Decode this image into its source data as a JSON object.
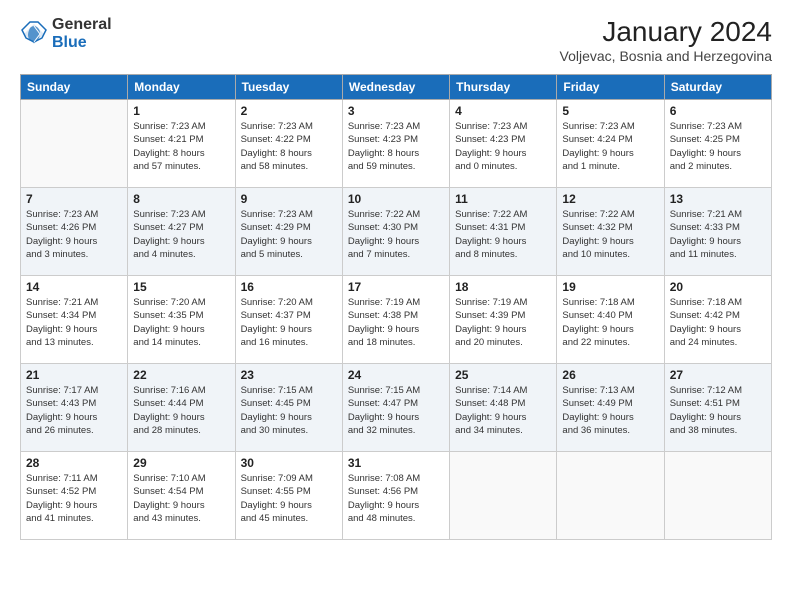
{
  "logo": {
    "general": "General",
    "blue": "Blue"
  },
  "title": "January 2024",
  "location": "Voljevac, Bosnia and Herzegovina",
  "headers": [
    "Sunday",
    "Monday",
    "Tuesday",
    "Wednesday",
    "Thursday",
    "Friday",
    "Saturday"
  ],
  "weeks": [
    [
      {
        "day": "",
        "info": ""
      },
      {
        "day": "1",
        "info": "Sunrise: 7:23 AM\nSunset: 4:21 PM\nDaylight: 8 hours\nand 57 minutes."
      },
      {
        "day": "2",
        "info": "Sunrise: 7:23 AM\nSunset: 4:22 PM\nDaylight: 8 hours\nand 58 minutes."
      },
      {
        "day": "3",
        "info": "Sunrise: 7:23 AM\nSunset: 4:23 PM\nDaylight: 8 hours\nand 59 minutes."
      },
      {
        "day": "4",
        "info": "Sunrise: 7:23 AM\nSunset: 4:23 PM\nDaylight: 9 hours\nand 0 minutes."
      },
      {
        "day": "5",
        "info": "Sunrise: 7:23 AM\nSunset: 4:24 PM\nDaylight: 9 hours\nand 1 minute."
      },
      {
        "day": "6",
        "info": "Sunrise: 7:23 AM\nSunset: 4:25 PM\nDaylight: 9 hours\nand 2 minutes."
      }
    ],
    [
      {
        "day": "7",
        "info": "Sunrise: 7:23 AM\nSunset: 4:26 PM\nDaylight: 9 hours\nand 3 minutes."
      },
      {
        "day": "8",
        "info": "Sunrise: 7:23 AM\nSunset: 4:27 PM\nDaylight: 9 hours\nand 4 minutes."
      },
      {
        "day": "9",
        "info": "Sunrise: 7:23 AM\nSunset: 4:29 PM\nDaylight: 9 hours\nand 5 minutes."
      },
      {
        "day": "10",
        "info": "Sunrise: 7:22 AM\nSunset: 4:30 PM\nDaylight: 9 hours\nand 7 minutes."
      },
      {
        "day": "11",
        "info": "Sunrise: 7:22 AM\nSunset: 4:31 PM\nDaylight: 9 hours\nand 8 minutes."
      },
      {
        "day": "12",
        "info": "Sunrise: 7:22 AM\nSunset: 4:32 PM\nDaylight: 9 hours\nand 10 minutes."
      },
      {
        "day": "13",
        "info": "Sunrise: 7:21 AM\nSunset: 4:33 PM\nDaylight: 9 hours\nand 11 minutes."
      }
    ],
    [
      {
        "day": "14",
        "info": "Sunrise: 7:21 AM\nSunset: 4:34 PM\nDaylight: 9 hours\nand 13 minutes."
      },
      {
        "day": "15",
        "info": "Sunrise: 7:20 AM\nSunset: 4:35 PM\nDaylight: 9 hours\nand 14 minutes."
      },
      {
        "day": "16",
        "info": "Sunrise: 7:20 AM\nSunset: 4:37 PM\nDaylight: 9 hours\nand 16 minutes."
      },
      {
        "day": "17",
        "info": "Sunrise: 7:19 AM\nSunset: 4:38 PM\nDaylight: 9 hours\nand 18 minutes."
      },
      {
        "day": "18",
        "info": "Sunrise: 7:19 AM\nSunset: 4:39 PM\nDaylight: 9 hours\nand 20 minutes."
      },
      {
        "day": "19",
        "info": "Sunrise: 7:18 AM\nSunset: 4:40 PM\nDaylight: 9 hours\nand 22 minutes."
      },
      {
        "day": "20",
        "info": "Sunrise: 7:18 AM\nSunset: 4:42 PM\nDaylight: 9 hours\nand 24 minutes."
      }
    ],
    [
      {
        "day": "21",
        "info": "Sunrise: 7:17 AM\nSunset: 4:43 PM\nDaylight: 9 hours\nand 26 minutes."
      },
      {
        "day": "22",
        "info": "Sunrise: 7:16 AM\nSunset: 4:44 PM\nDaylight: 9 hours\nand 28 minutes."
      },
      {
        "day": "23",
        "info": "Sunrise: 7:15 AM\nSunset: 4:45 PM\nDaylight: 9 hours\nand 30 minutes."
      },
      {
        "day": "24",
        "info": "Sunrise: 7:15 AM\nSunset: 4:47 PM\nDaylight: 9 hours\nand 32 minutes."
      },
      {
        "day": "25",
        "info": "Sunrise: 7:14 AM\nSunset: 4:48 PM\nDaylight: 9 hours\nand 34 minutes."
      },
      {
        "day": "26",
        "info": "Sunrise: 7:13 AM\nSunset: 4:49 PM\nDaylight: 9 hours\nand 36 minutes."
      },
      {
        "day": "27",
        "info": "Sunrise: 7:12 AM\nSunset: 4:51 PM\nDaylight: 9 hours\nand 38 minutes."
      }
    ],
    [
      {
        "day": "28",
        "info": "Sunrise: 7:11 AM\nSunset: 4:52 PM\nDaylight: 9 hours\nand 41 minutes."
      },
      {
        "day": "29",
        "info": "Sunrise: 7:10 AM\nSunset: 4:54 PM\nDaylight: 9 hours\nand 43 minutes."
      },
      {
        "day": "30",
        "info": "Sunrise: 7:09 AM\nSunset: 4:55 PM\nDaylight: 9 hours\nand 45 minutes."
      },
      {
        "day": "31",
        "info": "Sunrise: 7:08 AM\nSunset: 4:56 PM\nDaylight: 9 hours\nand 48 minutes."
      },
      {
        "day": "",
        "info": ""
      },
      {
        "day": "",
        "info": ""
      },
      {
        "day": "",
        "info": ""
      }
    ]
  ]
}
